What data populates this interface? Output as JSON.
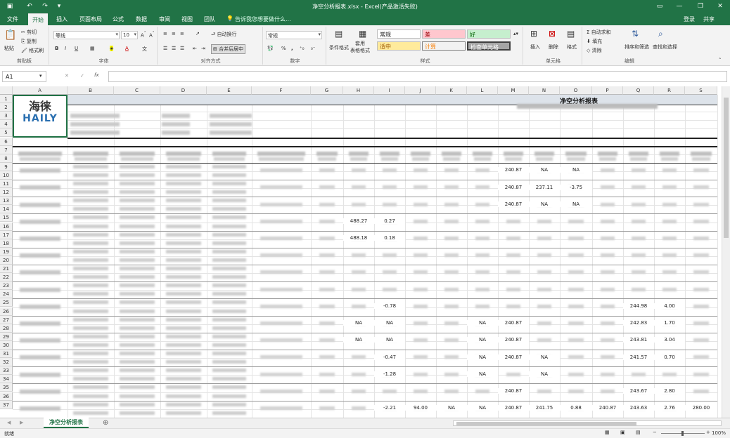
{
  "window": {
    "title": "净空分析报表.xlsx - Excel(产品激活失败)"
  },
  "tabs": [
    {
      "label": "文件"
    },
    {
      "label": "开始"
    },
    {
      "label": "插入"
    },
    {
      "label": "页面布局"
    },
    {
      "label": "公式"
    },
    {
      "label": "数据"
    },
    {
      "label": "审阅"
    },
    {
      "label": "视图"
    },
    {
      "label": "团队"
    }
  ],
  "tell_me": "告诉我您想要做什么...",
  "account": {
    "login": "登录",
    "share": "共享"
  },
  "ribbon": {
    "paste": "粘贴",
    "cut": "剪切",
    "copy": "复制",
    "format_painter": "格式刷",
    "clipboard": "剪贴板",
    "font_name": "等线",
    "font_size": "10",
    "font": "字体",
    "wrap": "自动换行",
    "merge": "合并后居中",
    "alignment": "对齐方式",
    "number_format": "常规",
    "number": "数字",
    "cond_format": "条件格式",
    "table_format": "套用\n表格格式",
    "style_normal": "常规",
    "style_bad": "差",
    "style_good": "好",
    "style_neutral": "适中",
    "style_calc": "计算",
    "style_check": "检查单元格",
    "styles": "样式",
    "insert": "插入",
    "delete": "删除",
    "format": "格式",
    "cells": "单元格",
    "autosum": "自动求和",
    "fill": "填充",
    "clear": "清除",
    "sort": "排序和筛选",
    "find": "查找和选择",
    "editing": "编辑"
  },
  "formula_bar": {
    "name_box": "A1",
    "fx": "fx"
  },
  "columns": [
    "A",
    "B",
    "C",
    "D",
    "E",
    "F",
    "G",
    "H",
    "I",
    "J",
    "K",
    "L",
    "M",
    "N",
    "O",
    "P",
    "Q",
    "R",
    "S"
  ],
  "rows": [
    "1",
    "2",
    "3",
    "4",
    "5",
    "6",
    "7",
    "8",
    "9",
    "10",
    "11",
    "12",
    "13",
    "14",
    "15",
    "16",
    "17",
    "18",
    "19",
    "20",
    "21",
    "22",
    "23",
    "24",
    "25",
    "26",
    "27",
    "28",
    "29",
    "30",
    "31",
    "32",
    "33",
    "34",
    "35",
    "36",
    "37"
  ],
  "report": {
    "logo_top": "海徕",
    "logo_bottom": "HAILY",
    "title": "净空分析报表"
  },
  "sheet_tab": "净空分析报表",
  "status": {
    "ready": "就绪",
    "zoom": "100%"
  },
  "visible_values": {
    "row9": [
      "240.87",
      "NA",
      "NA"
    ],
    "row11": [
      "240.87",
      "237.11",
      "-3.75"
    ],
    "row13": [
      "240.87",
      "NA",
      "NA"
    ],
    "row15": [
      "488.27",
      "0.27"
    ],
    "row17": [
      "488.18",
      "0.18"
    ],
    "row25": [
      "-0.78",
      "244.98",
      "4.00"
    ],
    "row27": [
      "NA",
      "NA",
      "NA",
      "240.87",
      "242.83",
      "1.70"
    ],
    "row29": [
      "NA",
      "NA",
      "NA",
      "240.87",
      "243.81",
      "3.04"
    ],
    "row31": [
      "-0.47",
      "NA",
      "NA",
      "240.87",
      "241.57",
      "0.70"
    ],
    "row33": [
      "-1.28",
      "NA",
      "NA"
    ],
    "row35": [
      "240.87",
      "243.67",
      "2.80"
    ],
    "row37": [
      "-2.21",
      "94.00",
      "NA",
      "NA",
      "240.87",
      "241.75",
      "0.88",
      "240.87",
      "243.63",
      "2.76",
      "280.00"
    ]
  }
}
